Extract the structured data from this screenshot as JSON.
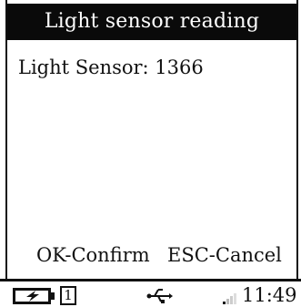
{
  "title": "Light sensor reading",
  "reading": "Light Sensor: 1366",
  "actions": {
    "ok": "OK-Confirm",
    "esc": "ESC-Cancel"
  },
  "status": {
    "sim": "1",
    "time": "11:49",
    "icons": [
      "battery-charging-icon",
      "usb-icon",
      "signal-icon"
    ]
  },
  "colors": {
    "title_bg": "#0a0a0a",
    "title_fg": "#ffffff",
    "text": "#111111",
    "background": "#ffffff"
  }
}
